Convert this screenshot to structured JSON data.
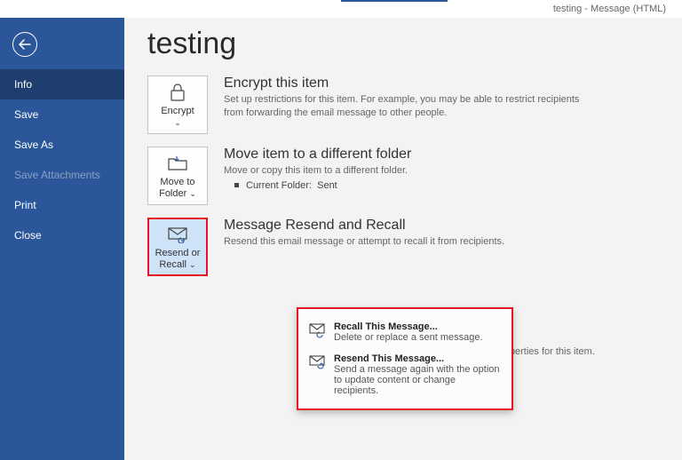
{
  "window": {
    "title": "testing  -  Message (HTML)"
  },
  "sidebar": {
    "items": [
      {
        "label": "Info",
        "state": "active"
      },
      {
        "label": "Save",
        "state": ""
      },
      {
        "label": "Save As",
        "state": ""
      },
      {
        "label": "Save Attachments",
        "state": "disabled"
      },
      {
        "label": "Print",
        "state": ""
      },
      {
        "label": "Close",
        "state": ""
      }
    ]
  },
  "page": {
    "title": "testing"
  },
  "sections": {
    "encrypt": {
      "tile_label": "Encrypt",
      "heading": "Encrypt this item",
      "desc": "Set up restrictions for this item. For example, you may be able to restrict recipients from forwarding the email message to other people."
    },
    "move": {
      "tile_label": "Move to Folder",
      "heading": "Move item to a different folder",
      "desc": "Move or copy this item to a different folder.",
      "folder_label": "Current Folder:",
      "folder_value": "Sent"
    },
    "resend": {
      "tile_label": "Resend or Recall",
      "heading": "Message Resend and Recall",
      "desc": "Resend this email message or attempt to recall it from recipients."
    },
    "properties": {
      "orphan_text": "properties for this item."
    }
  },
  "dropdown": {
    "recall": {
      "title": "Recall This Message...",
      "desc": "Delete or replace a sent message."
    },
    "resend": {
      "title": "Resend This Message...",
      "desc": "Send a message again with the option to update content or change recipients."
    }
  }
}
